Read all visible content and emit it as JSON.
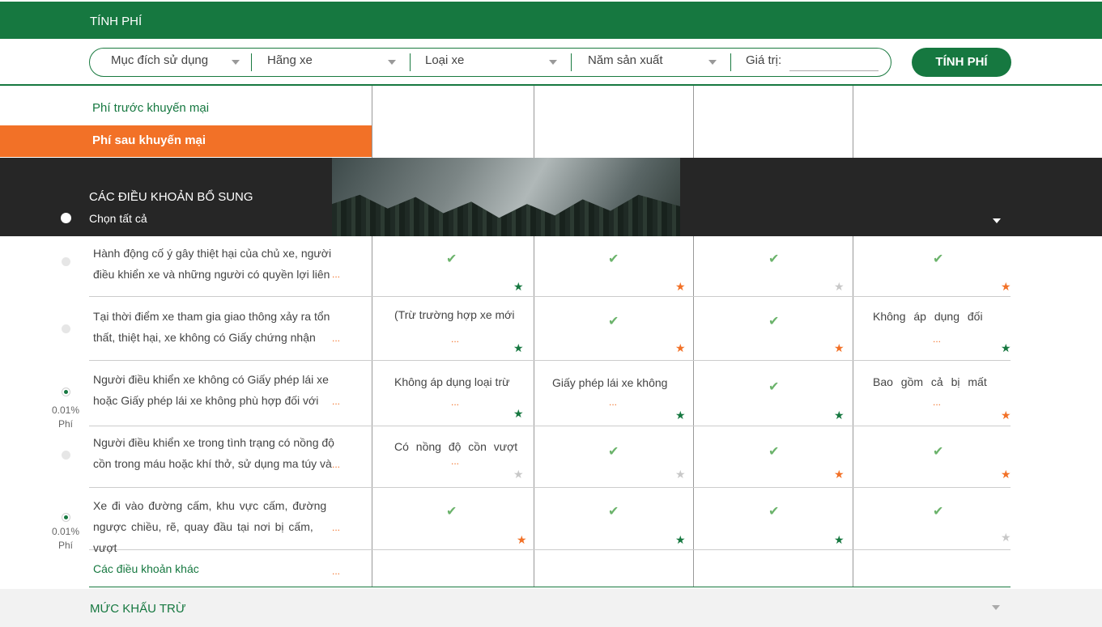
{
  "header": {
    "title": "TÍNH PHÍ"
  },
  "filters": {
    "purpose": "Mục đích sử dụng",
    "brand": "Hãng xe",
    "type": "Loại xe",
    "year": "Năm sản xuất",
    "value_label": "Giá trị:",
    "value": ""
  },
  "calc_button": "TÍNH PHÍ",
  "fees": {
    "before": "Phí trước khuyến mại",
    "after": "Phí sau khuyến mại"
  },
  "banner": {
    "title": "CÁC ĐIỀU KHOẢN BỔ SUNG",
    "select_all": "Chọn tất cả"
  },
  "clauses": [
    {
      "line1": "Hành động cố ý gây thiệt hại của chủ xe, người",
      "line2": "điều khiển xe và những người có quyền lợi liên",
      "ellipsis": "...",
      "fee": ""
    },
    {
      "line1": "Tại thời điểm xe tham gia giao thông xảy ra tổn",
      "line2": "thất, thiệt hại, xe không có Giấy chứng nhận",
      "ellipsis": "...",
      "fee": ""
    },
    {
      "line1": "Người điều khiển xe không có Giấy phép lái xe",
      "line2": "hoặc Giấy phép lái xe không phù hợp đối với",
      "ellipsis": "...",
      "fee": "0.01%",
      "fee_unit": "Phí"
    },
    {
      "line1": "Người điều khiển xe trong tình trạng có nồng độ",
      "line2": "cồn trong máu hoặc khí thở, sử dụng ma túy và",
      "ellipsis": "...",
      "fee": ""
    },
    {
      "line1": "Xe đi vào đường cấm, khu vực cấm, đường",
      "line2": "ngược chiều, rẽ, quay đầu tại nơi bị cấm, vượt",
      "ellipsis": "...",
      "fee": "0.01%",
      "fee_unit": "Phí"
    }
  ],
  "cells": {
    "r1": [
      "✔",
      "✔",
      "✔",
      "✔"
    ],
    "r2": [
      "(Trừ trường hợp xe mới",
      "✔",
      "✔",
      "Không áp dụng đối"
    ],
    "r3": [
      "Không áp dụng loại trừ",
      "Giấy phép lái xe không",
      "✔",
      "Bao gồm cả bị mất"
    ],
    "r4": [
      "Có nồng độ cồn vượt",
      "✔",
      "✔",
      "✔"
    ],
    "r5": [
      "✔",
      "✔",
      "✔",
      "✔"
    ]
  },
  "cell_ellipsis": "...",
  "star_glyph": "★",
  "colors": {
    "green": "#167840",
    "orange": "#f27127",
    "grey": "#c8c8c8"
  },
  "other_clauses": "Các điều khoản khác",
  "other_ellipsis": "...",
  "footer": {
    "title": "MỨC KHẤU TRỪ"
  }
}
